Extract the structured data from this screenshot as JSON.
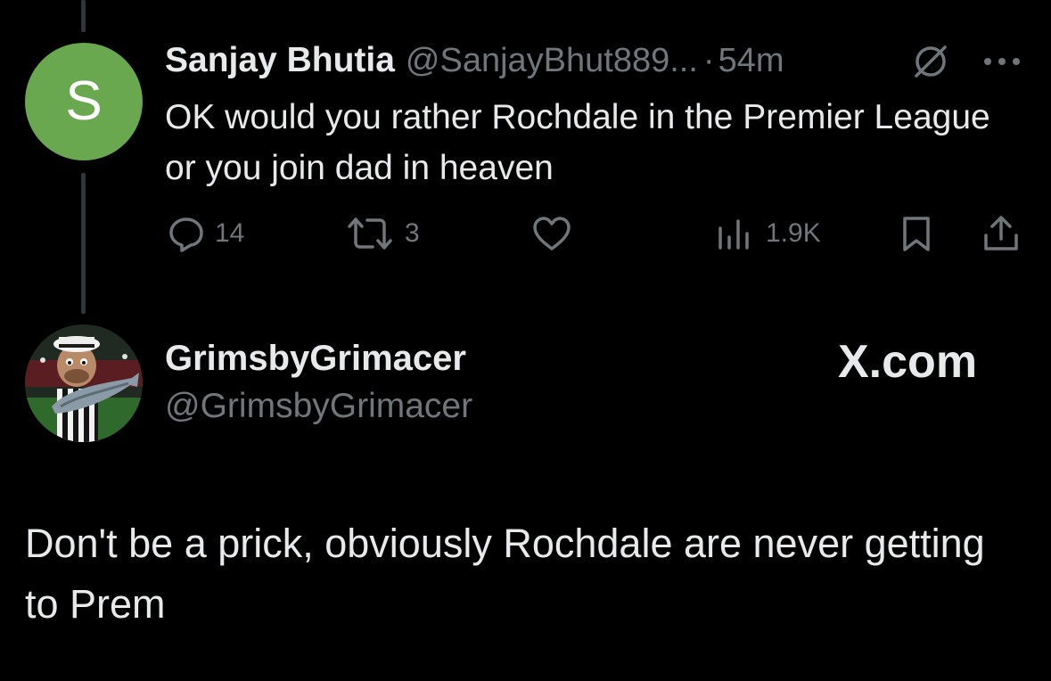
{
  "tweet": {
    "avatar_letter": "S",
    "display_name": "Sanjay Bhutia",
    "handle": "@SanjayBhut889...",
    "separator": "·",
    "time": "54m",
    "text": "OK would you rather Rochdale in the Premier League or you join dad in heaven",
    "actions": {
      "reply_count": "14",
      "retweet_count": "3",
      "views_count": "1.9K"
    },
    "icons": [
      "reply-icon",
      "retweet-icon",
      "like-icon",
      "views-icon",
      "bookmark-icon",
      "share-icon",
      "slash-icon",
      "more-icon"
    ]
  },
  "quoted": {
    "display_name": "GrimsbyGrimacer",
    "handle": "@GrimsbyGrimacer",
    "brand": "X.com",
    "text": "Don't be a prick, obviously Rochdale are never getting to Prem"
  },
  "colors": {
    "background": "#000000",
    "text_primary": "#e7e9ea",
    "text_secondary": "#71767b",
    "avatar_green": "#6aa84f",
    "thread_line": "#333639"
  }
}
